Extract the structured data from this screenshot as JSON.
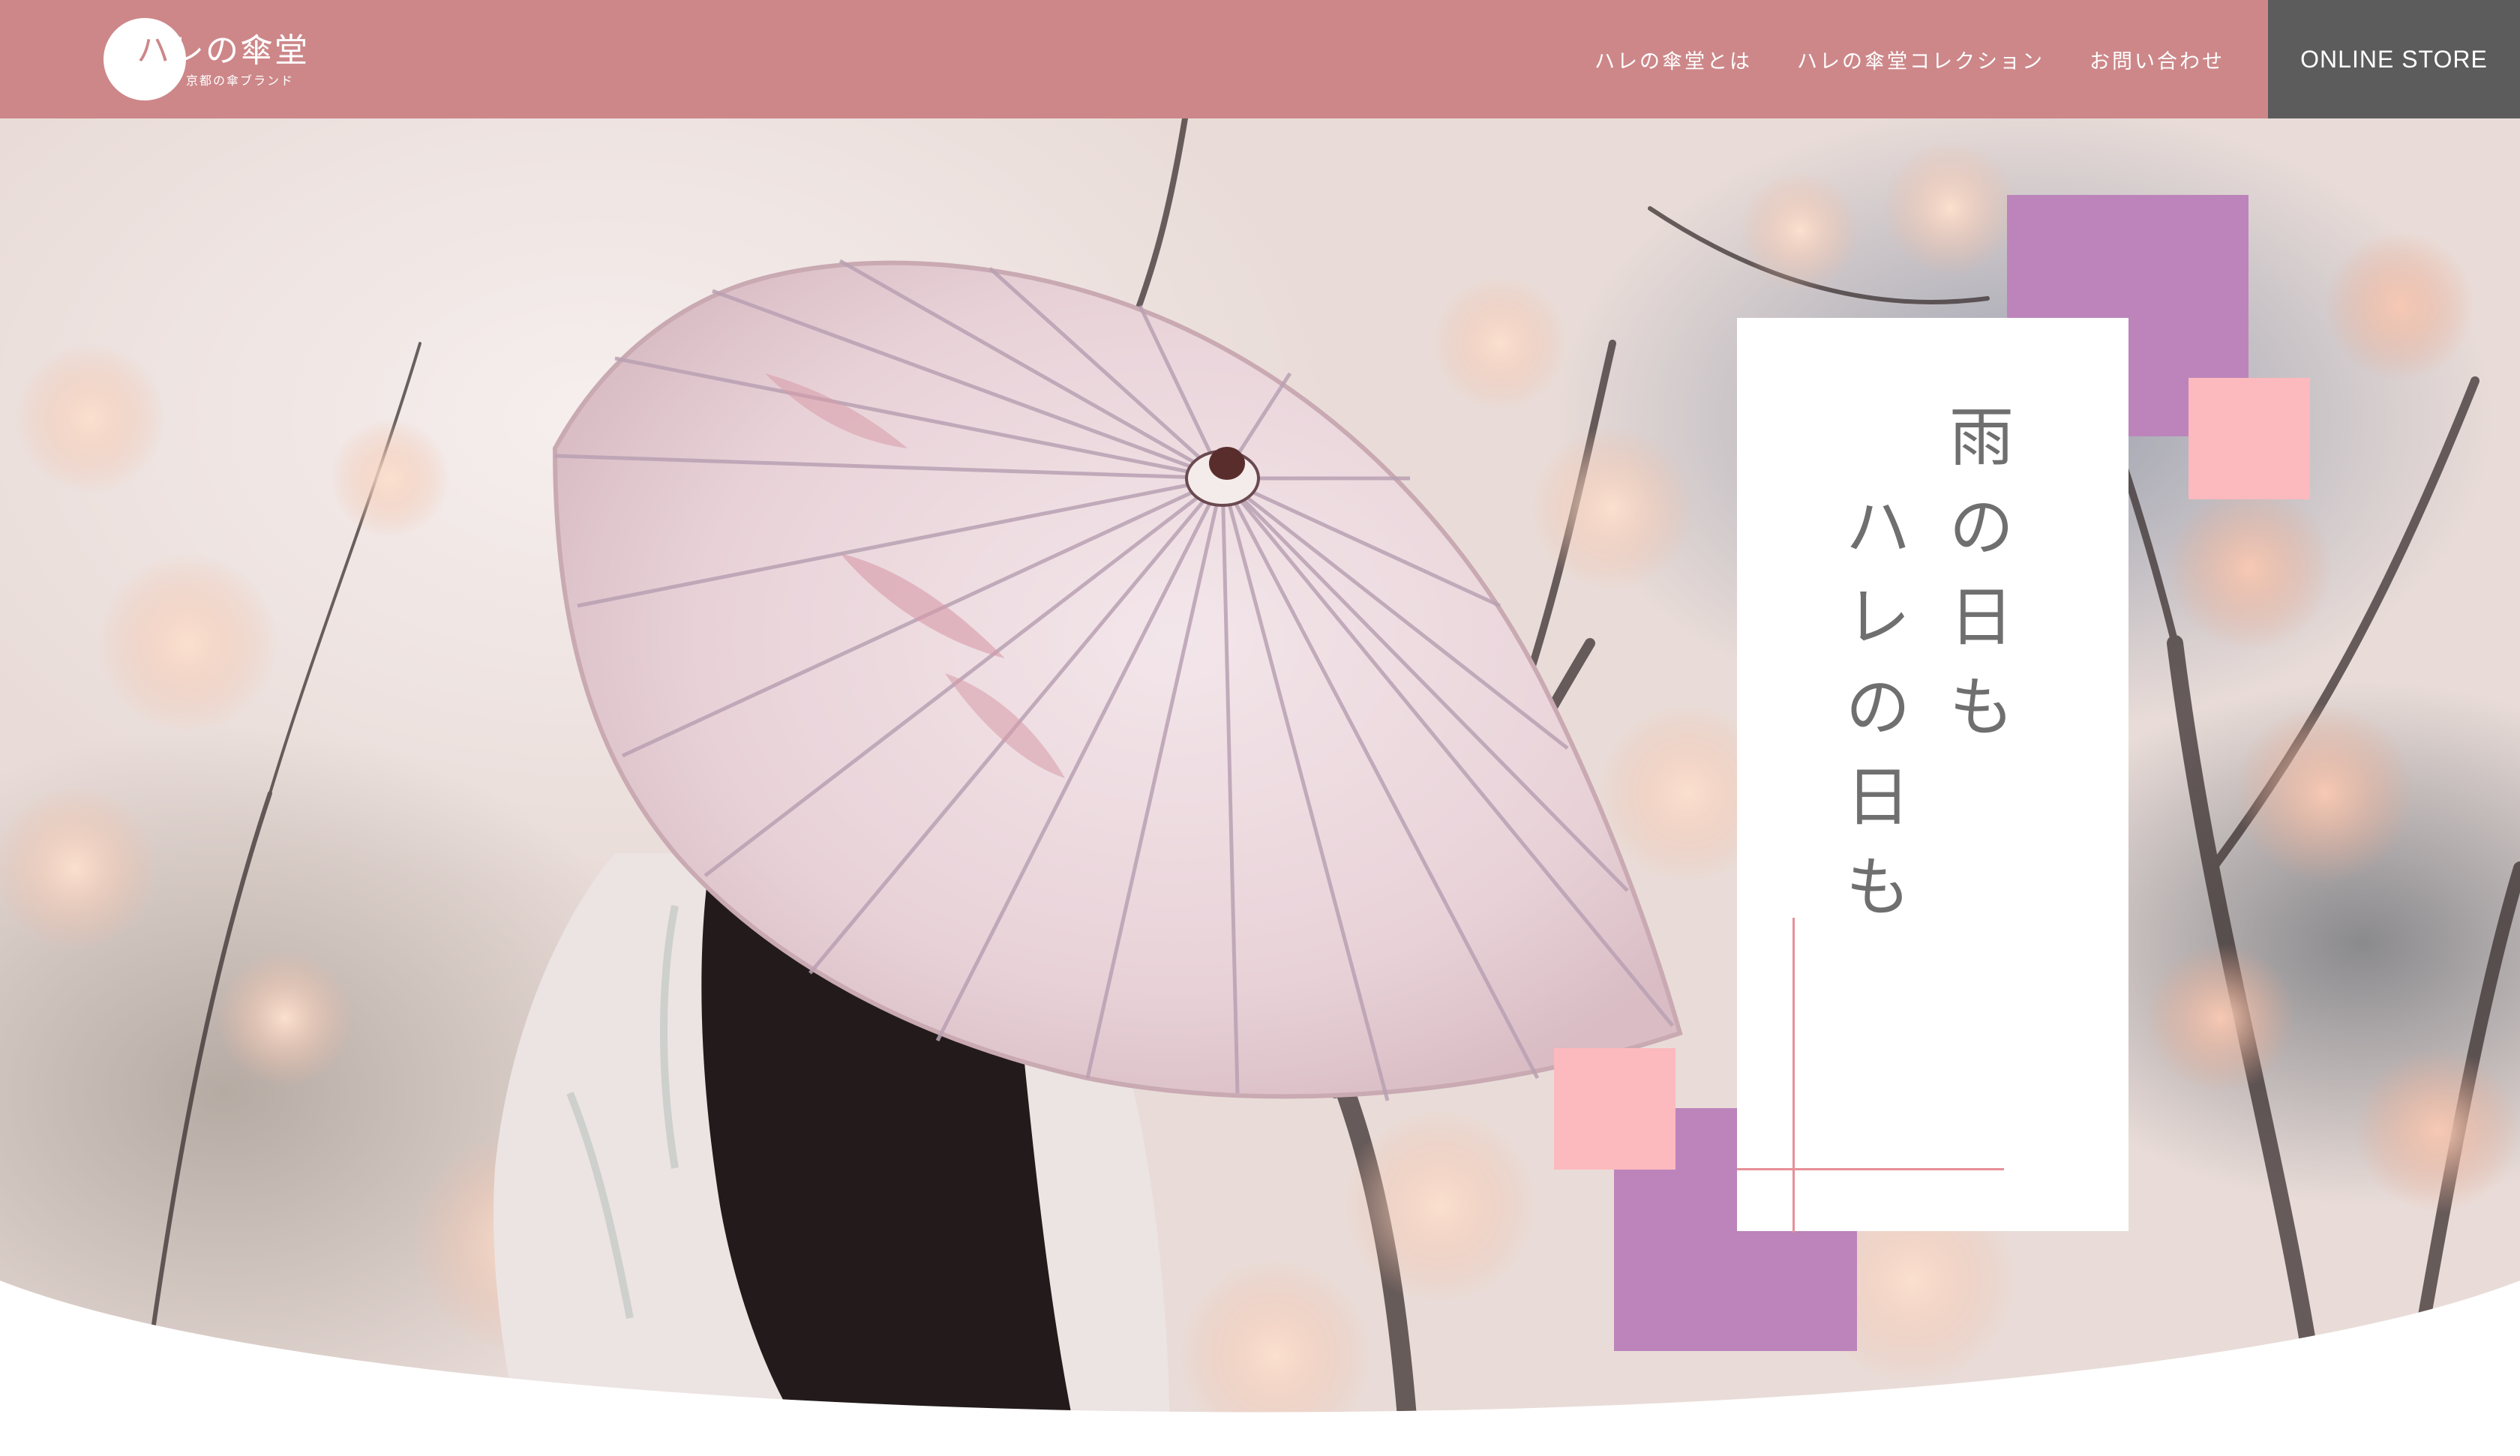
{
  "header": {
    "background_color": "#cd8789",
    "logo": {
      "title_first": "ハ",
      "title_rest": "レの傘堂",
      "subtitle": "京都の傘ブランド"
    },
    "nav": [
      {
        "label": "ハレの傘堂とは"
      },
      {
        "label": "ハレの傘堂コレクション"
      },
      {
        "label": "お問い合わせ"
      }
    ],
    "store_button": {
      "label": "ONLINE STORE",
      "color": "#5c5c5c"
    }
  },
  "hero": {
    "catchphrase": {
      "line1": [
        "雨",
        "の",
        "日",
        "も"
      ],
      "line2": [
        "ハ",
        "レ",
        "の",
        "日",
        "も"
      ]
    },
    "accent_colors": {
      "purple": "#bc84bb",
      "pink": "#fcb9be",
      "line": "#e68f98"
    }
  }
}
